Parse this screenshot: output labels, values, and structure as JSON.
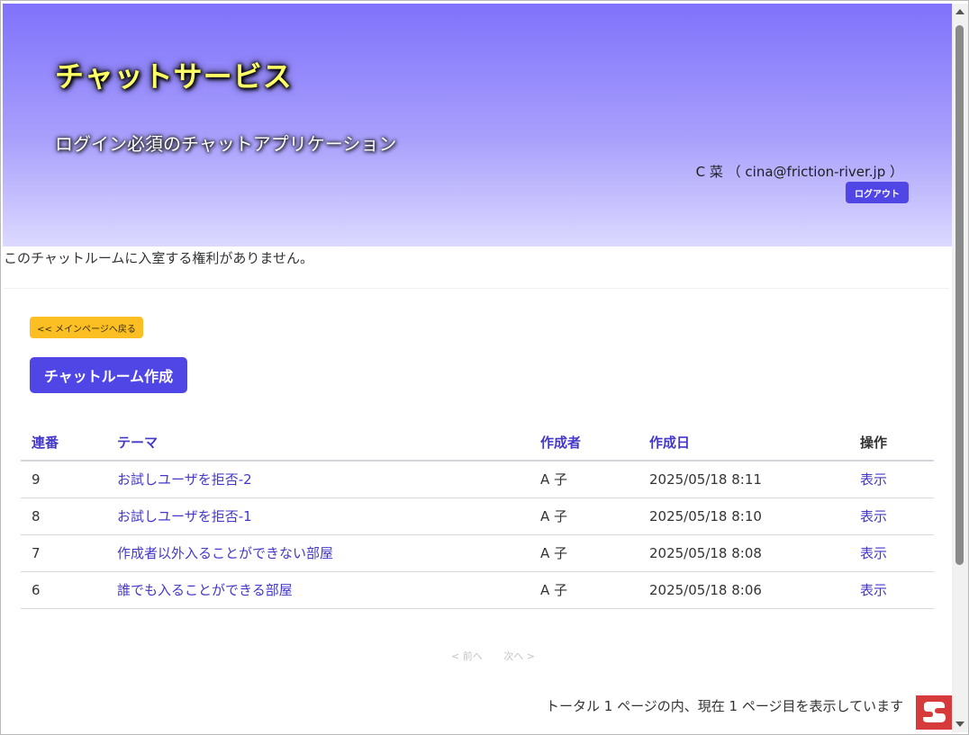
{
  "header": {
    "title": "チャットサービス",
    "subtitle": "ログイン必須のチャットアプリケーション",
    "user_info": "C 菜 （ cina@friction-river.jp ）",
    "logout_label": "ログアウト"
  },
  "notice": "このチャットルームに入室する権利がありません。",
  "actions": {
    "back_label": "<< メインページへ戻る",
    "create_label": "チャットルーム作成"
  },
  "table": {
    "headers": [
      "連番",
      "テーマ",
      "作成者",
      "作成日",
      "操作"
    ],
    "rows": [
      {
        "no": "9",
        "theme": "お試しユーザを拒否-2",
        "author": "A 子",
        "date": "2025/05/18 8:11",
        "op": "表示"
      },
      {
        "no": "8",
        "theme": "お試しユーザを拒否-1",
        "author": "A 子",
        "date": "2025/05/18 8:10",
        "op": "表示"
      },
      {
        "no": "7",
        "theme": "作成者以外入ることができない部屋",
        "author": "A 子",
        "date": "2025/05/18 8:08",
        "op": "表示"
      },
      {
        "no": "6",
        "theme": "誰でも入ることができる部屋",
        "author": "A 子",
        "date": "2025/05/18 8:06",
        "op": "表示"
      }
    ]
  },
  "pager": {
    "prev_label": "< 前へ",
    "next_label": "次へ >",
    "total_text": "トータル 1 ページの内、現在 1 ページ目を表示しています"
  },
  "colors": {
    "accent": "#4f46e5",
    "link": "#4338ca",
    "back_button": "#fbbf24",
    "title_text": "#ffff66",
    "widget": "#d63a3a"
  },
  "icons": {
    "floating_widget": "chat-widget-icon"
  }
}
